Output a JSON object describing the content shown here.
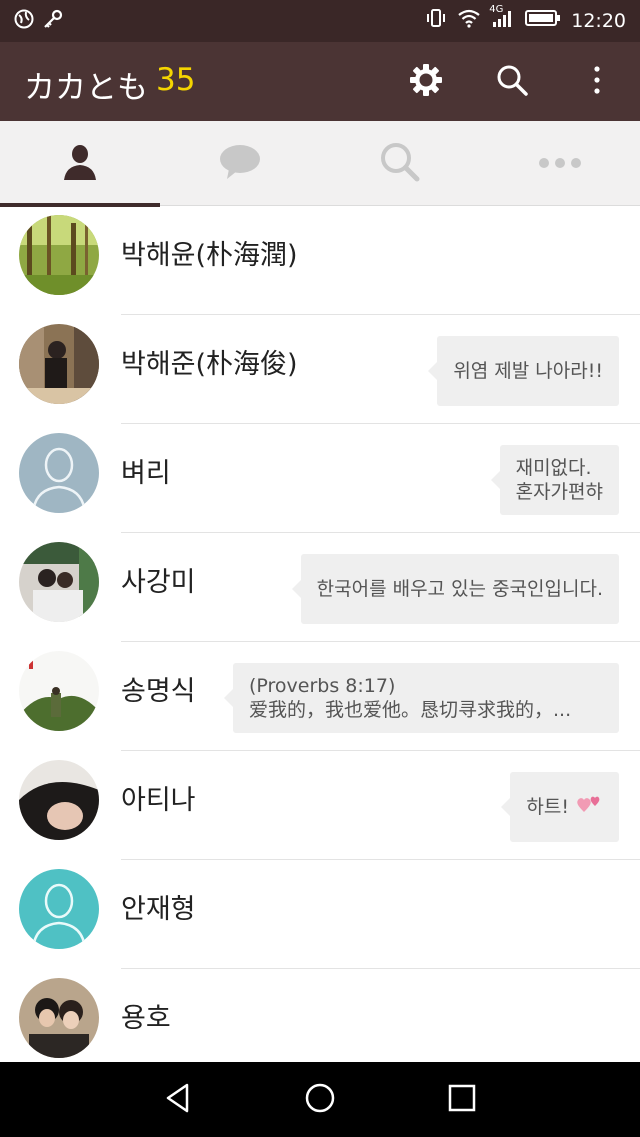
{
  "status_bar": {
    "time": "12:20",
    "network": "4G"
  },
  "app_bar": {
    "title": "カカとも",
    "count": "35"
  },
  "tabs": [
    {
      "icon": "person-icon",
      "active": true
    },
    {
      "icon": "chat-bubble-icon",
      "active": false
    },
    {
      "icon": "search-icon",
      "active": false
    },
    {
      "icon": "more-dots-icon",
      "active": false
    }
  ],
  "friends": [
    {
      "name": "박해윤(朴海潤)",
      "status": ""
    },
    {
      "name": "박해준(朴海俊)",
      "status": "위염 제발 나아라!!"
    },
    {
      "name": "벼리",
      "status_line1": "재미없다.",
      "status_line2": "혼자가편햐"
    },
    {
      "name": "사강미",
      "status": "한국어를 배우고 있는 중국인입니다."
    },
    {
      "name": "송명식",
      "status_line1": "(Proverbs  8:17)",
      "status_line2": "爱我的，我也爱他。恳切寻求我的，..."
    },
    {
      "name": "아티나",
      "status": "하트!"
    },
    {
      "name": "안재형",
      "status": ""
    },
    {
      "name": "용호",
      "status": ""
    }
  ],
  "colors": {
    "status_bar": "#3a2727",
    "app_bar": "#4b3434",
    "accent_count": "#f5d500",
    "tab_active": "#3f2b2b"
  }
}
